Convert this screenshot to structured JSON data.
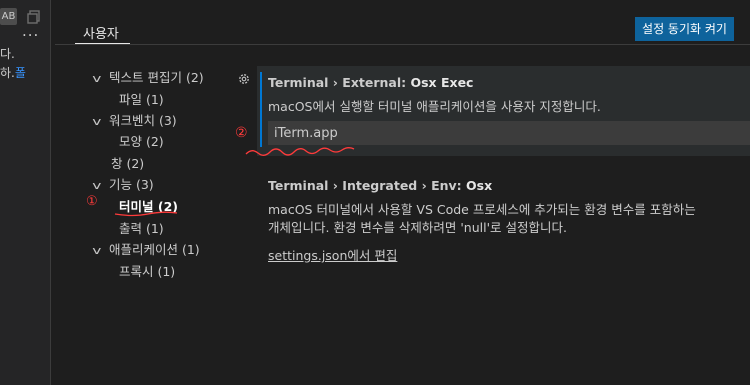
{
  "left_panel": {
    "badge": "AB",
    "more": "...",
    "line1": "다.",
    "line2_prefix": "하.",
    "line2_accent": "폴"
  },
  "header": {
    "tab_user": "사용자",
    "sync_button": "설정 동기화 켜기"
  },
  "toc": [
    {
      "label": "텍스트 편집기 (2)",
      "expanded": true
    },
    {
      "label": "파일 (1)"
    },
    {
      "label": "워크벤치 (3)",
      "expanded": true
    },
    {
      "label": "모양 (2)"
    },
    {
      "label": "창 (2)"
    },
    {
      "label": "기능 (3)",
      "expanded": true
    },
    {
      "label": "터미널 (2)",
      "active": true
    },
    {
      "label": "출력 (1)"
    },
    {
      "label": "애플리케이션 (1)",
      "expanded": true
    },
    {
      "label": "프록시 (1)"
    }
  ],
  "settings": [
    {
      "category": "Terminal › External: ",
      "name": "Osx Exec",
      "description": "macOS에서 실행할 터미널 애플리케이션을 사용자 지정합니다.",
      "value": "iTerm.app"
    },
    {
      "category": "Terminal › Integrated › Env: ",
      "name": "Osx",
      "description_line1": "macOS 터미널에서 사용할 VS Code 프로세스에 추가되는 환경 변수를 포함하는",
      "description_line2": "개체입니다. 환경 변수를 삭제하려면 'null'로 설정합니다.",
      "link": "settings.json에서 편집"
    }
  ],
  "annotations": {
    "mark1": "①",
    "mark2": "②"
  },
  "colors": {
    "accent": "#0078d4",
    "button": "#0e639c",
    "annotation": "#ff3b3b"
  }
}
